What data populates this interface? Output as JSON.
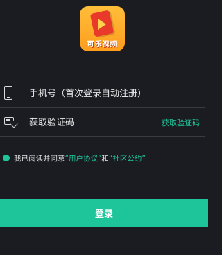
{
  "app": {
    "logo_text": "可乐视频",
    "icon": "cola-video-logo-icon"
  },
  "form": {
    "phone_placeholder": "手机号（首次登录自动注册）",
    "phone_icon": "phone-icon",
    "code_placeholder": "获取验证码",
    "code_icon": "sms-code-icon",
    "get_code_label": "获取验证码"
  },
  "agreement": {
    "prefix": "我已阅读并同意",
    "user_agreement": "“用户协议”",
    "and": "和",
    "community_rules": "“社区公约”",
    "checked": true
  },
  "login": {
    "label": "登录"
  },
  "colors": {
    "background": "#1b1c22",
    "accent": "#1fc59a",
    "text": "#e6e6e6"
  }
}
